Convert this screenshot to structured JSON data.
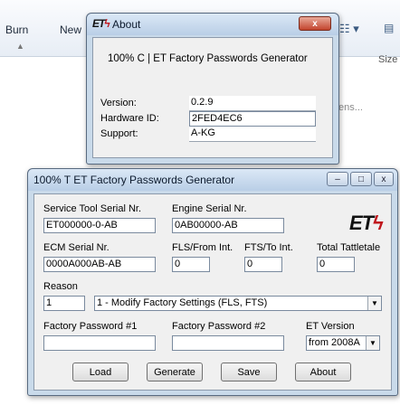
{
  "background": {
    "toolbar": {
      "burn_label": "Burn",
      "new_label": "New",
      "size_label": "Size"
    },
    "partial_text": "tens..."
  },
  "about": {
    "title": "About",
    "product_line": "100% C  |  ET Factory Passwords Generator",
    "version_label": "Version:",
    "version_value": "0.2.9",
    "hardware_label": "Hardware ID:",
    "hardware_value": "2FED4EC6",
    "support_label": "Support:",
    "support_value": "A-KG",
    "close_glyph": "x"
  },
  "main": {
    "title": "100%      T ET Factory Passwords Generator",
    "caption": {
      "min": "–",
      "max": "□",
      "close": "x"
    },
    "logo_text": "ET",
    "service_tool": {
      "label": "Service Tool Serial Nr.",
      "value": "ET000000-0-AB"
    },
    "engine_serial": {
      "label": "Engine Serial Nr.",
      "value": "0AB00000-AB"
    },
    "ecm_serial": {
      "label": "ECM Serial Nr.",
      "value": "0000A000AB-AB"
    },
    "fls": {
      "label": "FLS/From Int.",
      "value": "0"
    },
    "fts": {
      "label": "FTS/To Int.",
      "value": "0"
    },
    "tattletale": {
      "label": "Total Tattletale",
      "value": "0"
    },
    "reason": {
      "label": "Reason",
      "code": "1",
      "selected": "1 - Modify Factory Settings (FLS, FTS)"
    },
    "password1": {
      "label": "Factory Password #1",
      "value": ""
    },
    "password2": {
      "label": "Factory Password #2",
      "value": ""
    },
    "et_version": {
      "label": "ET Version",
      "selected": "from 2008A"
    },
    "buttons": {
      "load": "Load",
      "generate": "Generate",
      "save": "Save",
      "about": "About"
    }
  }
}
